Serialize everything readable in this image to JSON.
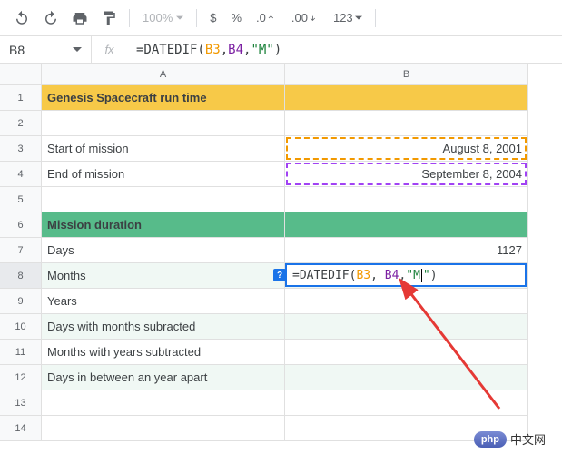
{
  "toolbar": {
    "zoom": "100%",
    "currency": "$",
    "percent": "%",
    "dec_dec": ".0",
    "dec_inc": ".00",
    "num_fmt": "123"
  },
  "formula_bar": {
    "cell_ref": "B8",
    "formula_prefix": "=DATEDIF(",
    "ref1": "B3",
    "sep1": ", ",
    "ref2": "B4",
    "sep2": ",",
    "str": "\"M\"",
    "suffix": ")"
  },
  "cols": {
    "a": "A",
    "b": "B"
  },
  "rows": [
    "1",
    "2",
    "3",
    "4",
    "5",
    "6",
    "7",
    "8",
    "9",
    "10",
    "11",
    "12",
    "13",
    "14"
  ],
  "cells": {
    "r1a": "Genesis Spacecraft run time",
    "r3a": "Start of mission",
    "r3b": "August 8, 2001",
    "r4a": "End of mission",
    "r4b": "September 8, 2004",
    "r6a": "Mission duration",
    "r7a": "Days",
    "r7b": "1127",
    "r8a": "Months",
    "r9a": "Years",
    "r10a": "Days with months subracted",
    "r11a": "Months with years subtracted",
    "r12a": "Days in between an year apart"
  },
  "editor": {
    "help": "?",
    "prefix": "=DATEDIF(",
    "ref1": "B3",
    "sep1": ", ",
    "ref2": "B4",
    "sep2": ",",
    "str_open": "\"M",
    "str_close": "\"",
    "suffix": ")"
  },
  "watermark": {
    "badge": "php",
    "text": "中文网"
  }
}
